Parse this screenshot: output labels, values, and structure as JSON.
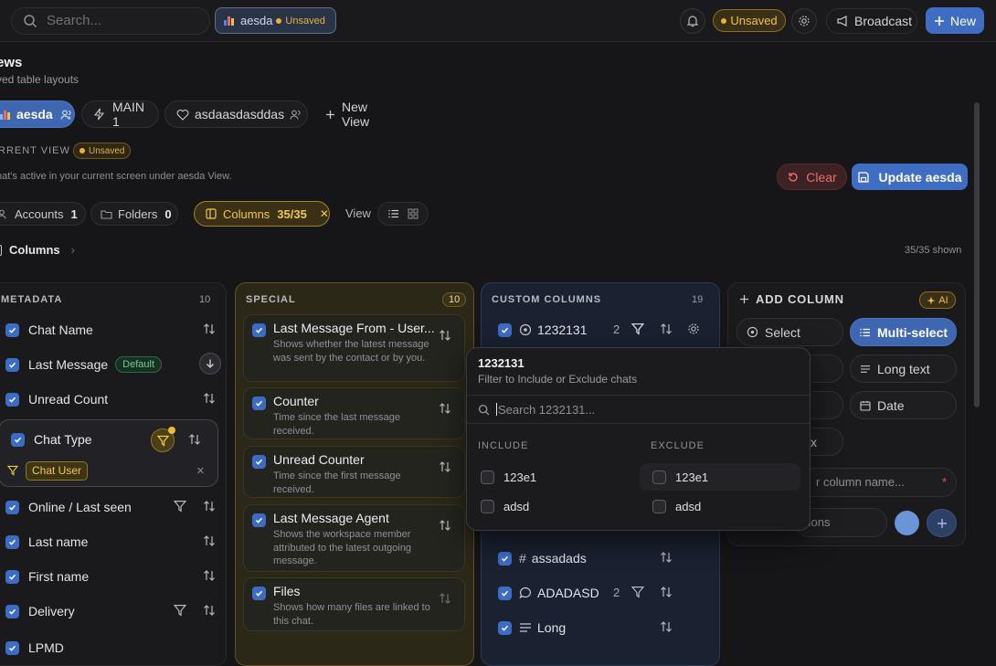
{
  "topbar": {
    "search_placeholder": "Search...",
    "view_chip": {
      "label": "aesda",
      "status": "Unsaved"
    },
    "unsaved_label": "Unsaved",
    "broadcast_label": "Broadcast",
    "new_label": "New"
  },
  "page": {
    "title": "ews",
    "subtitle": "ved table layouts",
    "tabs": [
      {
        "label": "aesda",
        "icon": "chart-icon",
        "active": true
      },
      {
        "label": "MAIN 1",
        "icon": "lightning-icon",
        "active": false
      },
      {
        "label": "asdaasdasddas",
        "icon": "heart-icon",
        "active": false
      },
      {
        "label": "New View",
        "icon": "plus-icon",
        "active": false
      }
    ],
    "current_view_label": "RRENT VIEW",
    "current_view_status": "Unsaved",
    "current_view_desc": "nat's active in your current screen under aesda View.",
    "clear_label": "Clear",
    "update_label": "Update aesda",
    "filters": {
      "accounts": {
        "label": "Accounts",
        "count": "1"
      },
      "folders": {
        "label": "Folders",
        "count": "0"
      },
      "columns": {
        "label": "Columns",
        "count": "35/35"
      },
      "view_label": "View"
    },
    "columns_header": "Columns",
    "shown": "35/35 shown"
  },
  "metadata": {
    "title": "METADATA",
    "count": "10",
    "items": [
      "Chat Name",
      "Last Message",
      "Unread Count",
      "Chat Type",
      "Online / Last seen",
      "Last name",
      "First name",
      "Delivery",
      "LPMD"
    ],
    "default_badge": "Default",
    "chat_type_filter": "Chat User"
  },
  "special": {
    "title": "SPECIAL",
    "count": "10",
    "items": [
      {
        "title": "Last Message From - User...",
        "desc": "Shows whether the latest message was sent by the contact or by you."
      },
      {
        "title": "Counter",
        "desc": "Time since the last message received."
      },
      {
        "title": "Unread Counter",
        "desc": "Time since the first message received."
      },
      {
        "title": "Last Message Agent",
        "desc": "Shows the workspace member attributed to the latest outgoing message."
      },
      {
        "title": "Files",
        "desc": "Shows how many files are linked to this chat."
      }
    ]
  },
  "custom": {
    "title": "CUSTOM COLUMNS",
    "count": "19",
    "items": [
      {
        "label": "1232131",
        "count": "2"
      },
      {
        "label": "assadads",
        "count": ""
      },
      {
        "label": "ADADASD",
        "count": "2"
      },
      {
        "label": "Long",
        "count": ""
      }
    ]
  },
  "add_column": {
    "title": "ADD COLUMN",
    "ai_label": "AI",
    "types": [
      {
        "label": "Select",
        "icon": "circle-icon",
        "selected": false
      },
      {
        "label": "Multi-select",
        "icon": "list-icon",
        "selected": true
      },
      {
        "label": "Long text",
        "icon": "text-icon",
        "selected": false
      },
      {
        "label": "Date",
        "icon": "calendar-icon",
        "selected": false
      },
      {
        "label": "x",
        "icon": "",
        "selected": false
      }
    ],
    "name_placeholder": "r column name...",
    "options_placeholder": "tions",
    "color": "#6a96d8"
  },
  "popup": {
    "title": "1232131",
    "subtitle": "Filter to Include or Exclude chats",
    "search_placeholder": "Search 1232131...",
    "include_label": "INCLUDE",
    "exclude_label": "EXCLUDE",
    "include_options": [
      "123e1",
      "adsd"
    ],
    "exclude_options": [
      "123e1",
      "adsd"
    ]
  },
  "colors": {
    "accent": "#3f6dc2",
    "warning": "#f0c24a",
    "danger": "#ef6b6b",
    "success": "#77c79a"
  }
}
